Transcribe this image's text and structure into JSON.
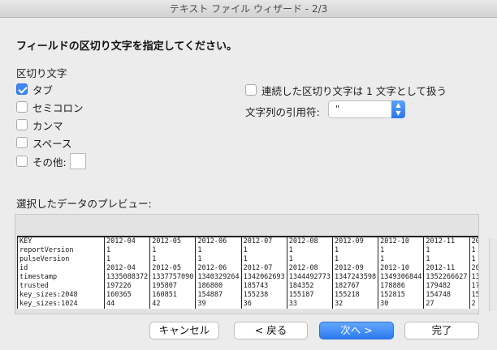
{
  "window": {
    "title": "テキスト ファイル ウィザード - 2/3"
  },
  "instruction": "フィールドの区切り文字を指定してください。",
  "delimiters": {
    "group_label": "区切り文字",
    "tab": {
      "label": "タブ",
      "checked": true
    },
    "semicolon": {
      "label": "セミコロン",
      "checked": false
    },
    "comma": {
      "label": "カンマ",
      "checked": false
    },
    "space": {
      "label": "スペース",
      "checked": false
    },
    "other": {
      "label": "その他:",
      "checked": false,
      "value": ""
    }
  },
  "options": {
    "consecutive": {
      "label": "連続した区切り文字は 1 文字として扱う",
      "checked": false
    },
    "text_qualifier": {
      "label": "文字列の引用符:",
      "value": "\""
    }
  },
  "preview": {
    "label": "選択したデータのプレビュー:",
    "rows": [
      [
        "KEY",
        "2012-04",
        "2012-05",
        "2012-06",
        "2012-07",
        "2012-08",
        "2012-09",
        "2012-10",
        "2012-11",
        "20"
      ],
      [
        "reportVersion",
        "1",
        "1",
        "1",
        "1",
        "1",
        "1",
        "1",
        "1",
        "1"
      ],
      [
        "pulseVersion",
        "1",
        "1",
        "1",
        "1",
        "1",
        "1",
        "1",
        "1",
        "1"
      ],
      [
        "id",
        "2012-04",
        "2012-05",
        "2012-06",
        "2012-07",
        "2012-08",
        "2012-09",
        "2012-10",
        "2012-11",
        "20"
      ],
      [
        "timestamp",
        "1335088372",
        "1337757090",
        "1340329264",
        "1342062693",
        "1344492773",
        "1347243598",
        "1349306844",
        "1352266627",
        "13"
      ],
      [
        "trusted",
        "197226",
        "195807",
        "186800",
        "185743",
        "184352",
        "182767",
        "178886",
        "179482",
        "17"
      ],
      [
        "key_sizes:2048",
        "160365",
        "160851",
        "154887",
        "155238",
        "155187",
        "155218",
        "152815",
        "154748",
        "15"
      ],
      [
        "key_sizes:1024",
        "44",
        "42",
        "39",
        "36",
        "33",
        "32",
        "30",
        "27",
        "2"
      ]
    ]
  },
  "buttons": {
    "cancel": "キャンセル",
    "back": "< 戻る",
    "next": "次へ >",
    "finish": "完了"
  }
}
